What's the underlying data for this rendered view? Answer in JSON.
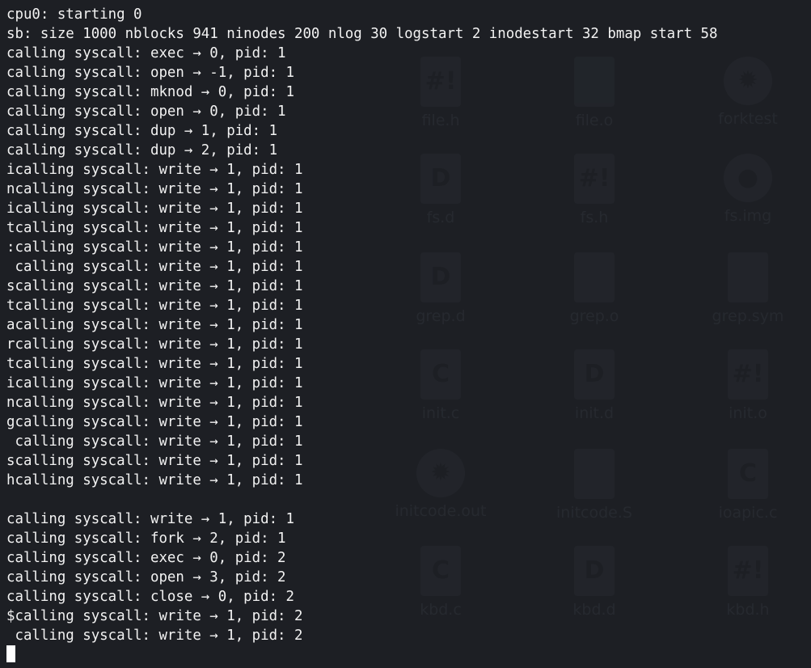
{
  "window": {
    "app": "terminal"
  },
  "background_files": [
    {
      "name": "file.h",
      "icon": "header-file-icon",
      "glyph": "#!"
    },
    {
      "name": "file.o",
      "icon": "object-file-icon",
      "glyph": ""
    },
    {
      "name": "forktest",
      "icon": "gear-icon",
      "glyph": "✹"
    },
    {
      "name": "fs.d",
      "icon": "d-file-icon",
      "glyph": "D"
    },
    {
      "name": "fs.h",
      "icon": "header-file-icon",
      "glyph": "#!"
    },
    {
      "name": "fs.img",
      "icon": "disk-image-icon",
      "glyph": "●"
    },
    {
      "name": "grep.d",
      "icon": "d-file-icon",
      "glyph": "D"
    },
    {
      "name": "grep.o",
      "icon": "object-file-icon",
      "glyph": ""
    },
    {
      "name": "grep.sym",
      "icon": "text-file-icon",
      "glyph": ""
    },
    {
      "name": "init.c",
      "icon": "c-file-icon",
      "glyph": "C"
    },
    {
      "name": "init.d",
      "icon": "d-file-icon",
      "glyph": "D"
    },
    {
      "name": "init.o",
      "icon": "object-file-icon",
      "glyph": "#!"
    },
    {
      "name": "initcode.out",
      "icon": "gear-icon",
      "glyph": "✹"
    },
    {
      "name": "initcode.S",
      "icon": "text-file-icon",
      "glyph": ""
    },
    {
      "name": "ioapic.c",
      "icon": "c-file-icon",
      "glyph": "C"
    },
    {
      "name": "kbd.c",
      "icon": "c-file-icon",
      "glyph": "C"
    },
    {
      "name": "kbd.d",
      "icon": "d-file-icon",
      "glyph": "D"
    },
    {
      "name": "kbd.h",
      "icon": "header-file-icon",
      "glyph": "#!"
    }
  ],
  "terminal": {
    "lines": [
      "cpu0: starting 0",
      "sb: size 1000 nblocks 941 ninodes 200 nlog 30 logstart 2 inodestart 32 bmap start 58",
      "calling syscall: exec → 0, pid: 1",
      "calling syscall: open → -1, pid: 1",
      "calling syscall: mknod → 0, pid: 1",
      "calling syscall: open → 0, pid: 1",
      "calling syscall: dup → 1, pid: 1",
      "calling syscall: dup → 2, pid: 1",
      "icalling syscall: write → 1, pid: 1",
      "ncalling syscall: write → 1, pid: 1",
      "icalling syscall: write → 1, pid: 1",
      "tcalling syscall: write → 1, pid: 1",
      ":calling syscall: write → 1, pid: 1",
      " calling syscall: write → 1, pid: 1",
      "scalling syscall: write → 1, pid: 1",
      "tcalling syscall: write → 1, pid: 1",
      "acalling syscall: write → 1, pid: 1",
      "rcalling syscall: write → 1, pid: 1",
      "tcalling syscall: write → 1, pid: 1",
      "icalling syscall: write → 1, pid: 1",
      "ncalling syscall: write → 1, pid: 1",
      "gcalling syscall: write → 1, pid: 1",
      " calling syscall: write → 1, pid: 1",
      "scalling syscall: write → 1, pid: 1",
      "hcalling syscall: write → 1, pid: 1",
      "",
      "calling syscall: write → 1, pid: 1",
      "calling syscall: fork → 2, pid: 1",
      "calling syscall: exec → 0, pid: 2",
      "calling syscall: open → 3, pid: 2",
      "calling syscall: close → 0, pid: 2",
      "$calling syscall: write → 1, pid: 2",
      " calling syscall: write → 1, pid: 2"
    ]
  }
}
